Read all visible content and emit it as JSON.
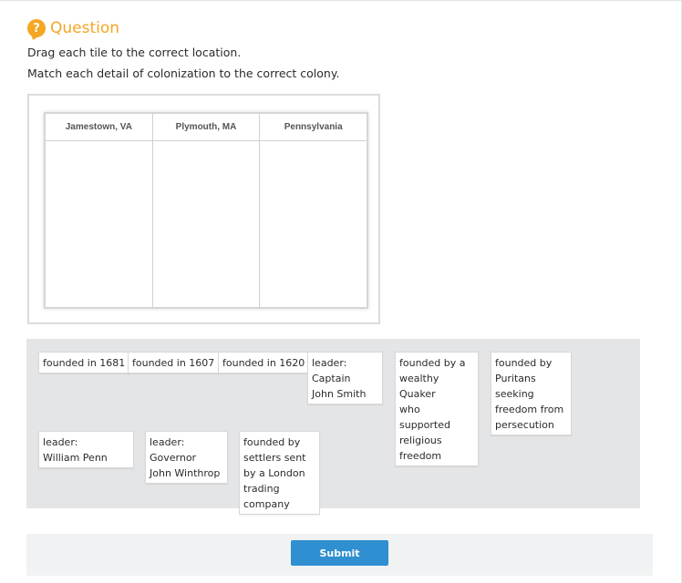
{
  "header": {
    "icon_glyph": "?",
    "title": "Question",
    "accent_color": "#f5a623"
  },
  "instructions": {
    "line1": "Drag each tile to the correct location.",
    "line2": "Match each detail of colonization to the correct colony."
  },
  "drop_table": {
    "columns": [
      "Jamestown, VA",
      "Plymouth, MA",
      "Pennsylvania"
    ]
  },
  "tiles": [
    "founded in 1681",
    "founded in 1607",
    "founded in 1620",
    "leader:\nCaptain\nJohn Smith",
    "founded by a\nwealthy Quaker\nwho supported\nreligious freedom",
    "founded by\nPuritans seeking\nfreedom from\npersecution",
    "leader:\nWilliam Penn",
    "leader: Governor\nJohn Winthrop",
    "founded by\nsettlers sent\nby a London\ntrading company"
  ],
  "submit": {
    "label": "Submit",
    "color": "#2f8fd0"
  }
}
